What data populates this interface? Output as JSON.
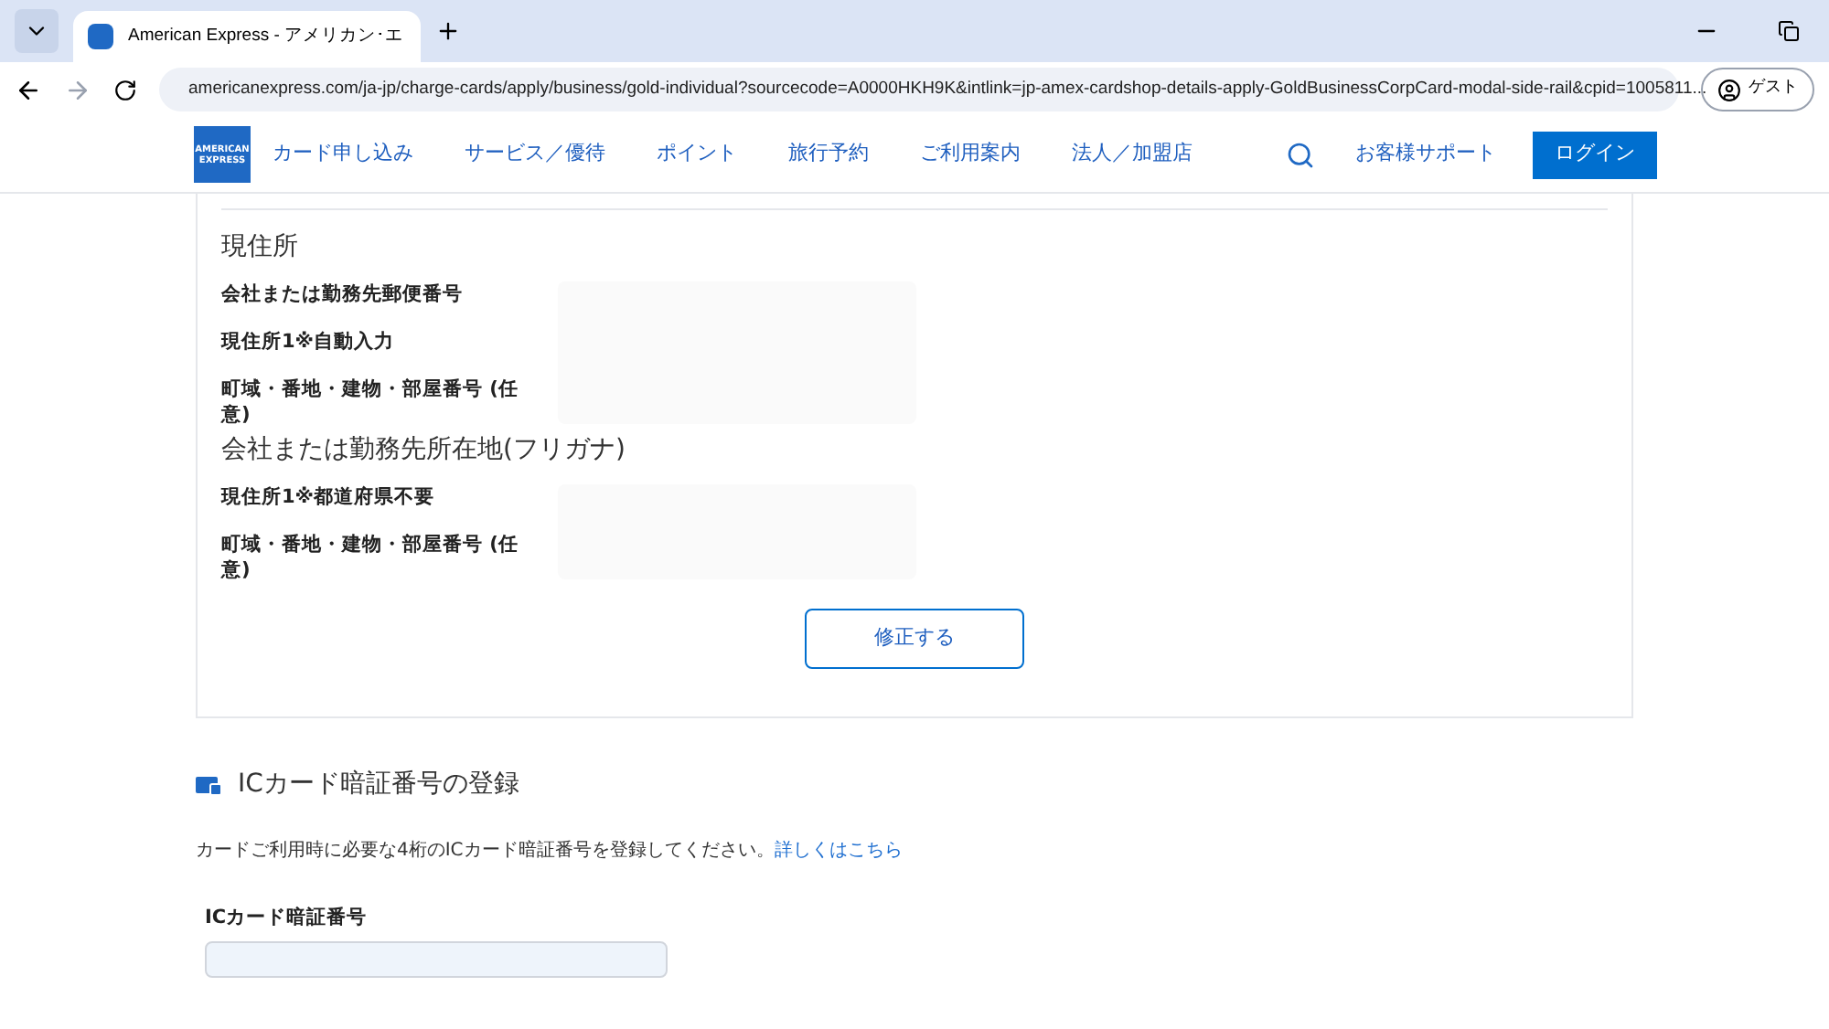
{
  "browser": {
    "tab": {
      "title": "American Express - アメリカン･エ"
    },
    "url": "americanexpress.com/ja-jp/charge-cards/apply/business/gold-individual?sourcecode=A0000HKH9K&intlink=jp-amex-cardshop-details-apply-GoldBusinessCorpCard-modal-side-rail&cpid=1005811...",
    "profile": "ゲスト"
  },
  "nav": {
    "logo": "AMERICAN EXPRESS",
    "items": [
      "カード申し込み",
      "サービス／優待",
      "ポイント",
      "旅行予約",
      "ご利用案内",
      "法人／加盟店"
    ],
    "support": "お客様サポート",
    "login": "ログイン"
  },
  "review": {
    "groups": [
      {
        "title": "現住所",
        "fields": [
          "会社または勤務先郵便番号",
          "現住所1※自動入力",
          "町域・番地・建物・部屋番号 (任意)"
        ]
      },
      {
        "title": "会社または勤務先所在地(フリガナ)",
        "fields": [
          "現住所1※都道府県不要",
          "町域・番地・建物・部屋番号 (任意)"
        ]
      }
    ],
    "edit_button": "修正する"
  },
  "pin_section": {
    "title": "ICカード暗証番号の登録",
    "description": "カードご利用時に必要な4桁のICカード暗証番号を登録してください。",
    "link": "詳しくはこちら",
    "field_label": "ICカード暗証番号"
  }
}
